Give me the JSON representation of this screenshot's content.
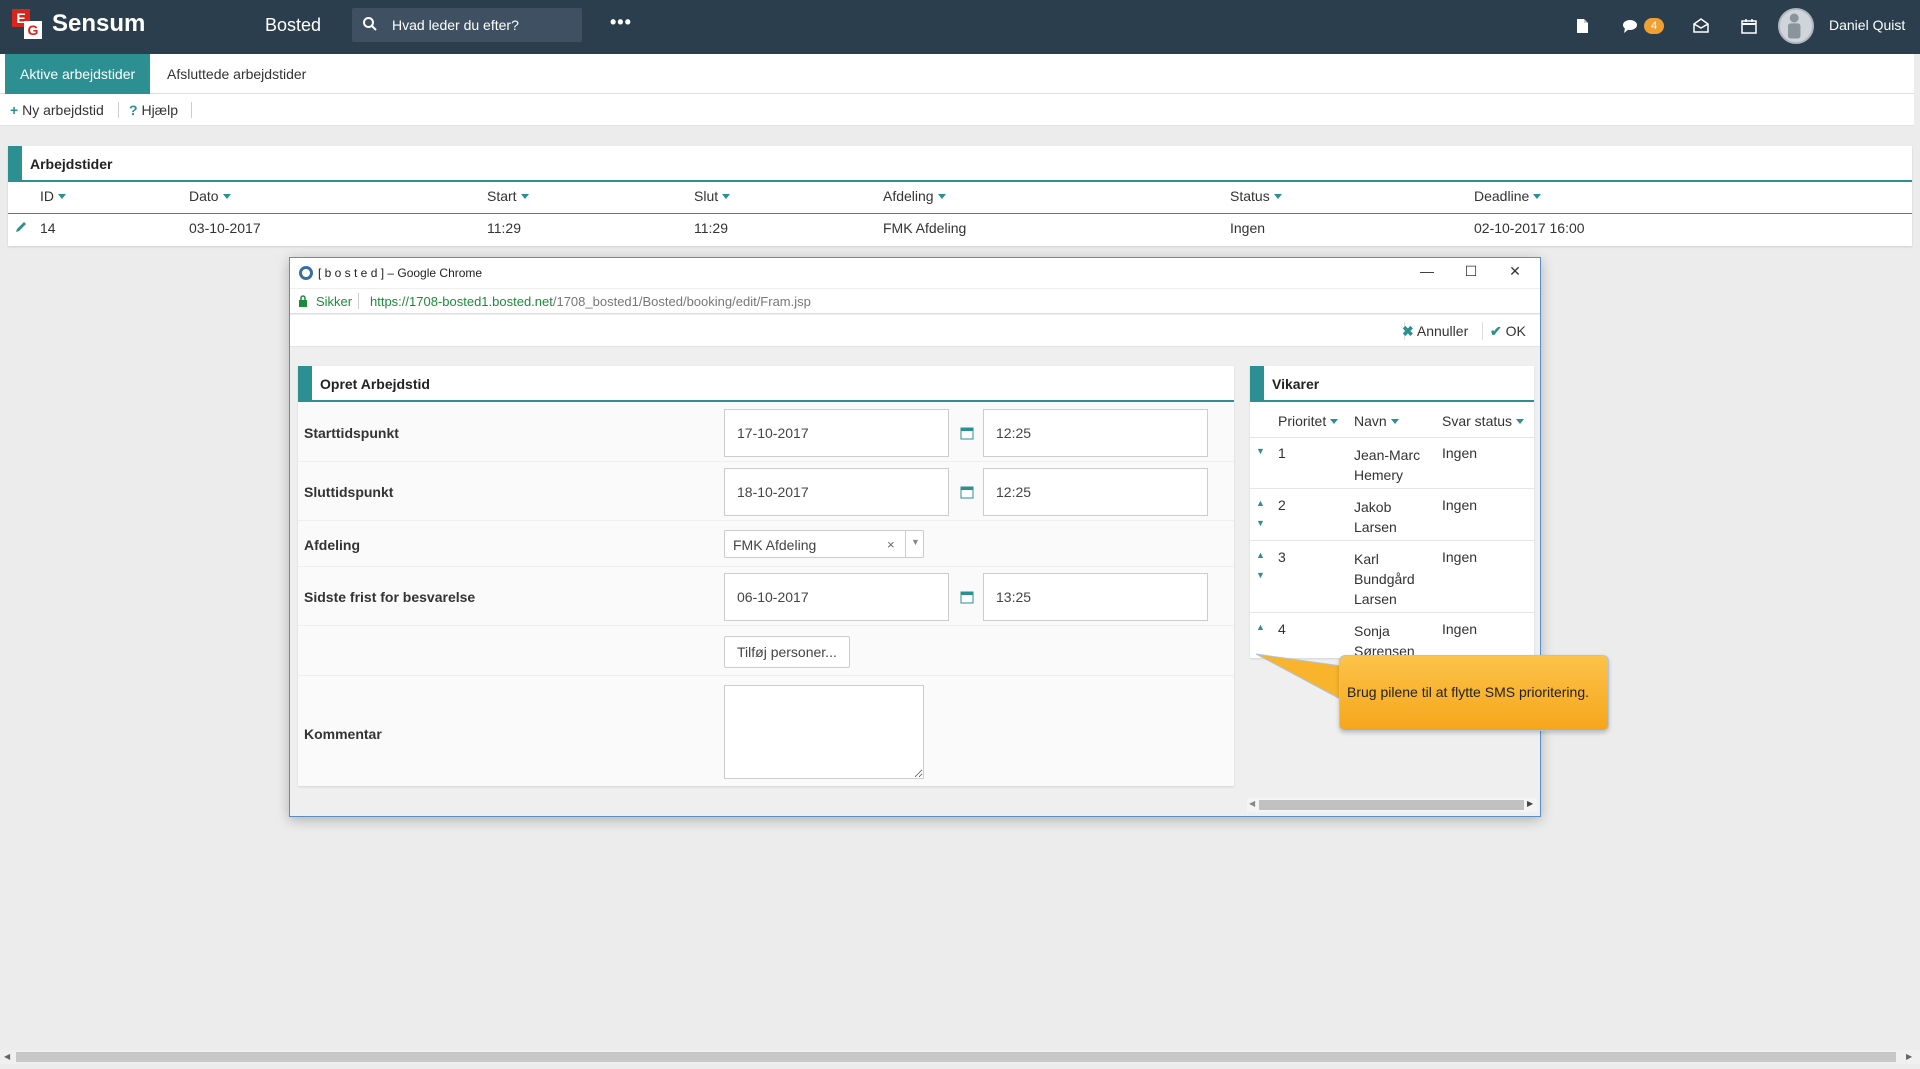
{
  "header": {
    "brand": "Sensum",
    "module": "Bosted",
    "search_placeholder": "Hvad leder du efter?",
    "more": "•••",
    "messages_badge": "4",
    "user_name": "Daniel Quist"
  },
  "tabs": [
    {
      "label": "Aktive arbejdstider",
      "active": true
    },
    {
      "label": "Afsluttede arbejdstider",
      "active": false
    }
  ],
  "toolbar": {
    "new_label": "Ny arbejdstid",
    "help_label": "Hjælp"
  },
  "list_panel": {
    "title": "Arbejdstider",
    "columns": [
      "ID",
      "Dato",
      "Start",
      "Slut",
      "Afdeling",
      "Status",
      "Deadline"
    ],
    "rows": [
      {
        "id": "14",
        "dato": "03-10-2017",
        "start": "11:29",
        "slut": "11:29",
        "afdeling": "FMK Afdeling",
        "status": "Ingen",
        "deadline": "02-10-2017 16:00"
      }
    ]
  },
  "popup": {
    "window_title": "[ b o s t e d ] – Google Chrome",
    "secure_label": "Sikker",
    "url_host": "https://1708-bosted1.bosted.net",
    "url_path": "/1708_bosted1/Bosted/booking/edit/Fram.jsp",
    "cancel_label": "Annuller",
    "ok_label": "OK",
    "form": {
      "title": "Opret Arbejdstid",
      "start_label": "Starttidspunkt",
      "start_date": "17-10-2017",
      "start_time": "12:25",
      "end_label": "Sluttidspunkt",
      "end_date": "18-10-2017",
      "end_time": "12:25",
      "dept_label": "Afdeling",
      "dept_value": "FMK Afdeling",
      "deadline_label": "Sidste frist for besvarelse",
      "deadline_date": "06-10-2017",
      "deadline_time": "13:25",
      "add_persons_label": "Tilføj personer...",
      "comment_label": "Kommentar",
      "comment_value": ""
    },
    "vikarer": {
      "title": "Vikarer",
      "columns": [
        "Prioritet",
        "Navn",
        "Svar status"
      ],
      "rows": [
        {
          "priority": "1",
          "name": "Jean-Marc Hemery",
          "status": "Ingen"
        },
        {
          "priority": "2",
          "name": "Jakob Larsen",
          "status": "Ingen"
        },
        {
          "priority": "3",
          "name": "Karl Bundgård Larsen",
          "status": "Ingen"
        },
        {
          "priority": "4",
          "name": "Sonja Sørensen",
          "status": "Ingen"
        }
      ]
    }
  },
  "tooltip": {
    "text": "Brug pilene til at flytte SMS prioritering."
  },
  "colors": {
    "topbar": "#2b3e4d",
    "accent": "#2c8f91",
    "badge": "#f0a030",
    "tooltip": "#f6a61b"
  }
}
